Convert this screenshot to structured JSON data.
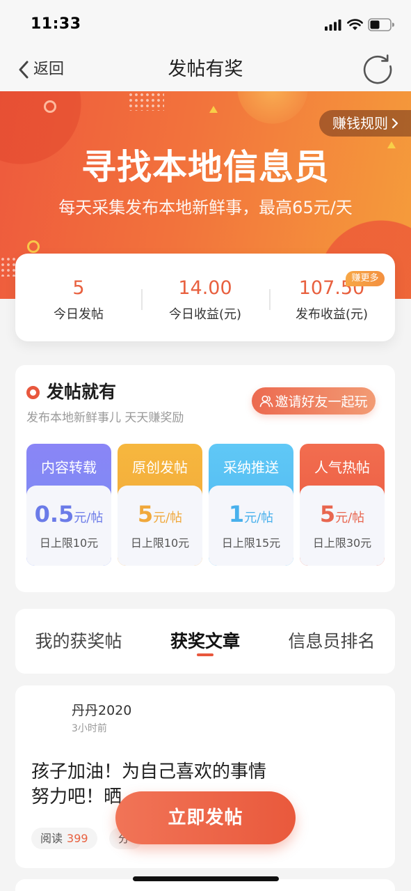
{
  "status_bar": {
    "time": "11:33",
    "icons": [
      "cellular-signal-icon",
      "wifi-icon",
      "battery-icon"
    ]
  },
  "nav": {
    "back_label": "返回",
    "title": "发帖有奖",
    "back_icon": "chevron-left-icon",
    "refresh_icon": "refresh-icon"
  },
  "banner": {
    "rules_label": "赚钱规则",
    "title": "寻找本地信息员",
    "subtitle": "每天采集发布本地新鲜事，最高65元/天"
  },
  "stats": {
    "items": [
      {
        "value": "5",
        "label": "今日发帖"
      },
      {
        "value": "14.00",
        "label": "今日收益(元)"
      },
      {
        "value": "107.50",
        "label": "发布收益(元)"
      }
    ],
    "badge": "赚更多",
    "value_color": "#e8603f"
  },
  "rewards": {
    "title": "发帖就有",
    "subtitle": "发布本地新鲜事儿 天天赚奖励",
    "invite_label": "邀请好友一起玩",
    "cards": [
      {
        "title": "内容转载",
        "amount": "0.5",
        "unit": "元/帖",
        "limit": "日上限10元",
        "color_top": "#8a85f6",
        "color_bottom": "#7590f2",
        "accent": "#6b7be8"
      },
      {
        "title": "原创发帖",
        "amount": "5",
        "unit": "元/帖",
        "limit": "日上限10元",
        "color_top": "#f6b73e",
        "color_bottom": "#f1a43a",
        "accent": "#f0a83b"
      },
      {
        "title": "采纳推送",
        "amount": "1",
        "unit": "元/帖",
        "limit": "日上限15元",
        "color_top": "#60c8f6",
        "color_bottom": "#4bb4ef",
        "accent": "#48b0ec"
      },
      {
        "title": "人气热帖",
        "amount": "5",
        "unit": "元/帖",
        "limit": "日上限30元",
        "color_top": "#f26d4f",
        "color_bottom": "#e8563e",
        "accent": "#e8664f"
      }
    ]
  },
  "tabs": {
    "items": [
      {
        "label": "我的获奖帖",
        "active": false
      },
      {
        "label": "获奖文章",
        "active": true
      },
      {
        "label": "信息员排名",
        "active": false
      }
    ],
    "indicator_color": "#e8573d"
  },
  "post": {
    "author": "丹丹2020",
    "time": "3小时前",
    "title": "孩子加油！为自己喜欢的事情努力吧！晒",
    "stats": [
      {
        "label": "阅读",
        "value": "399"
      },
      {
        "label": "分",
        "value": ""
      }
    ]
  },
  "fab": {
    "label": "立即发帖"
  },
  "colors": {
    "brand_start": "#ee5a3d",
    "brand_end": "#f59d3b",
    "accent": "#e8573d"
  }
}
